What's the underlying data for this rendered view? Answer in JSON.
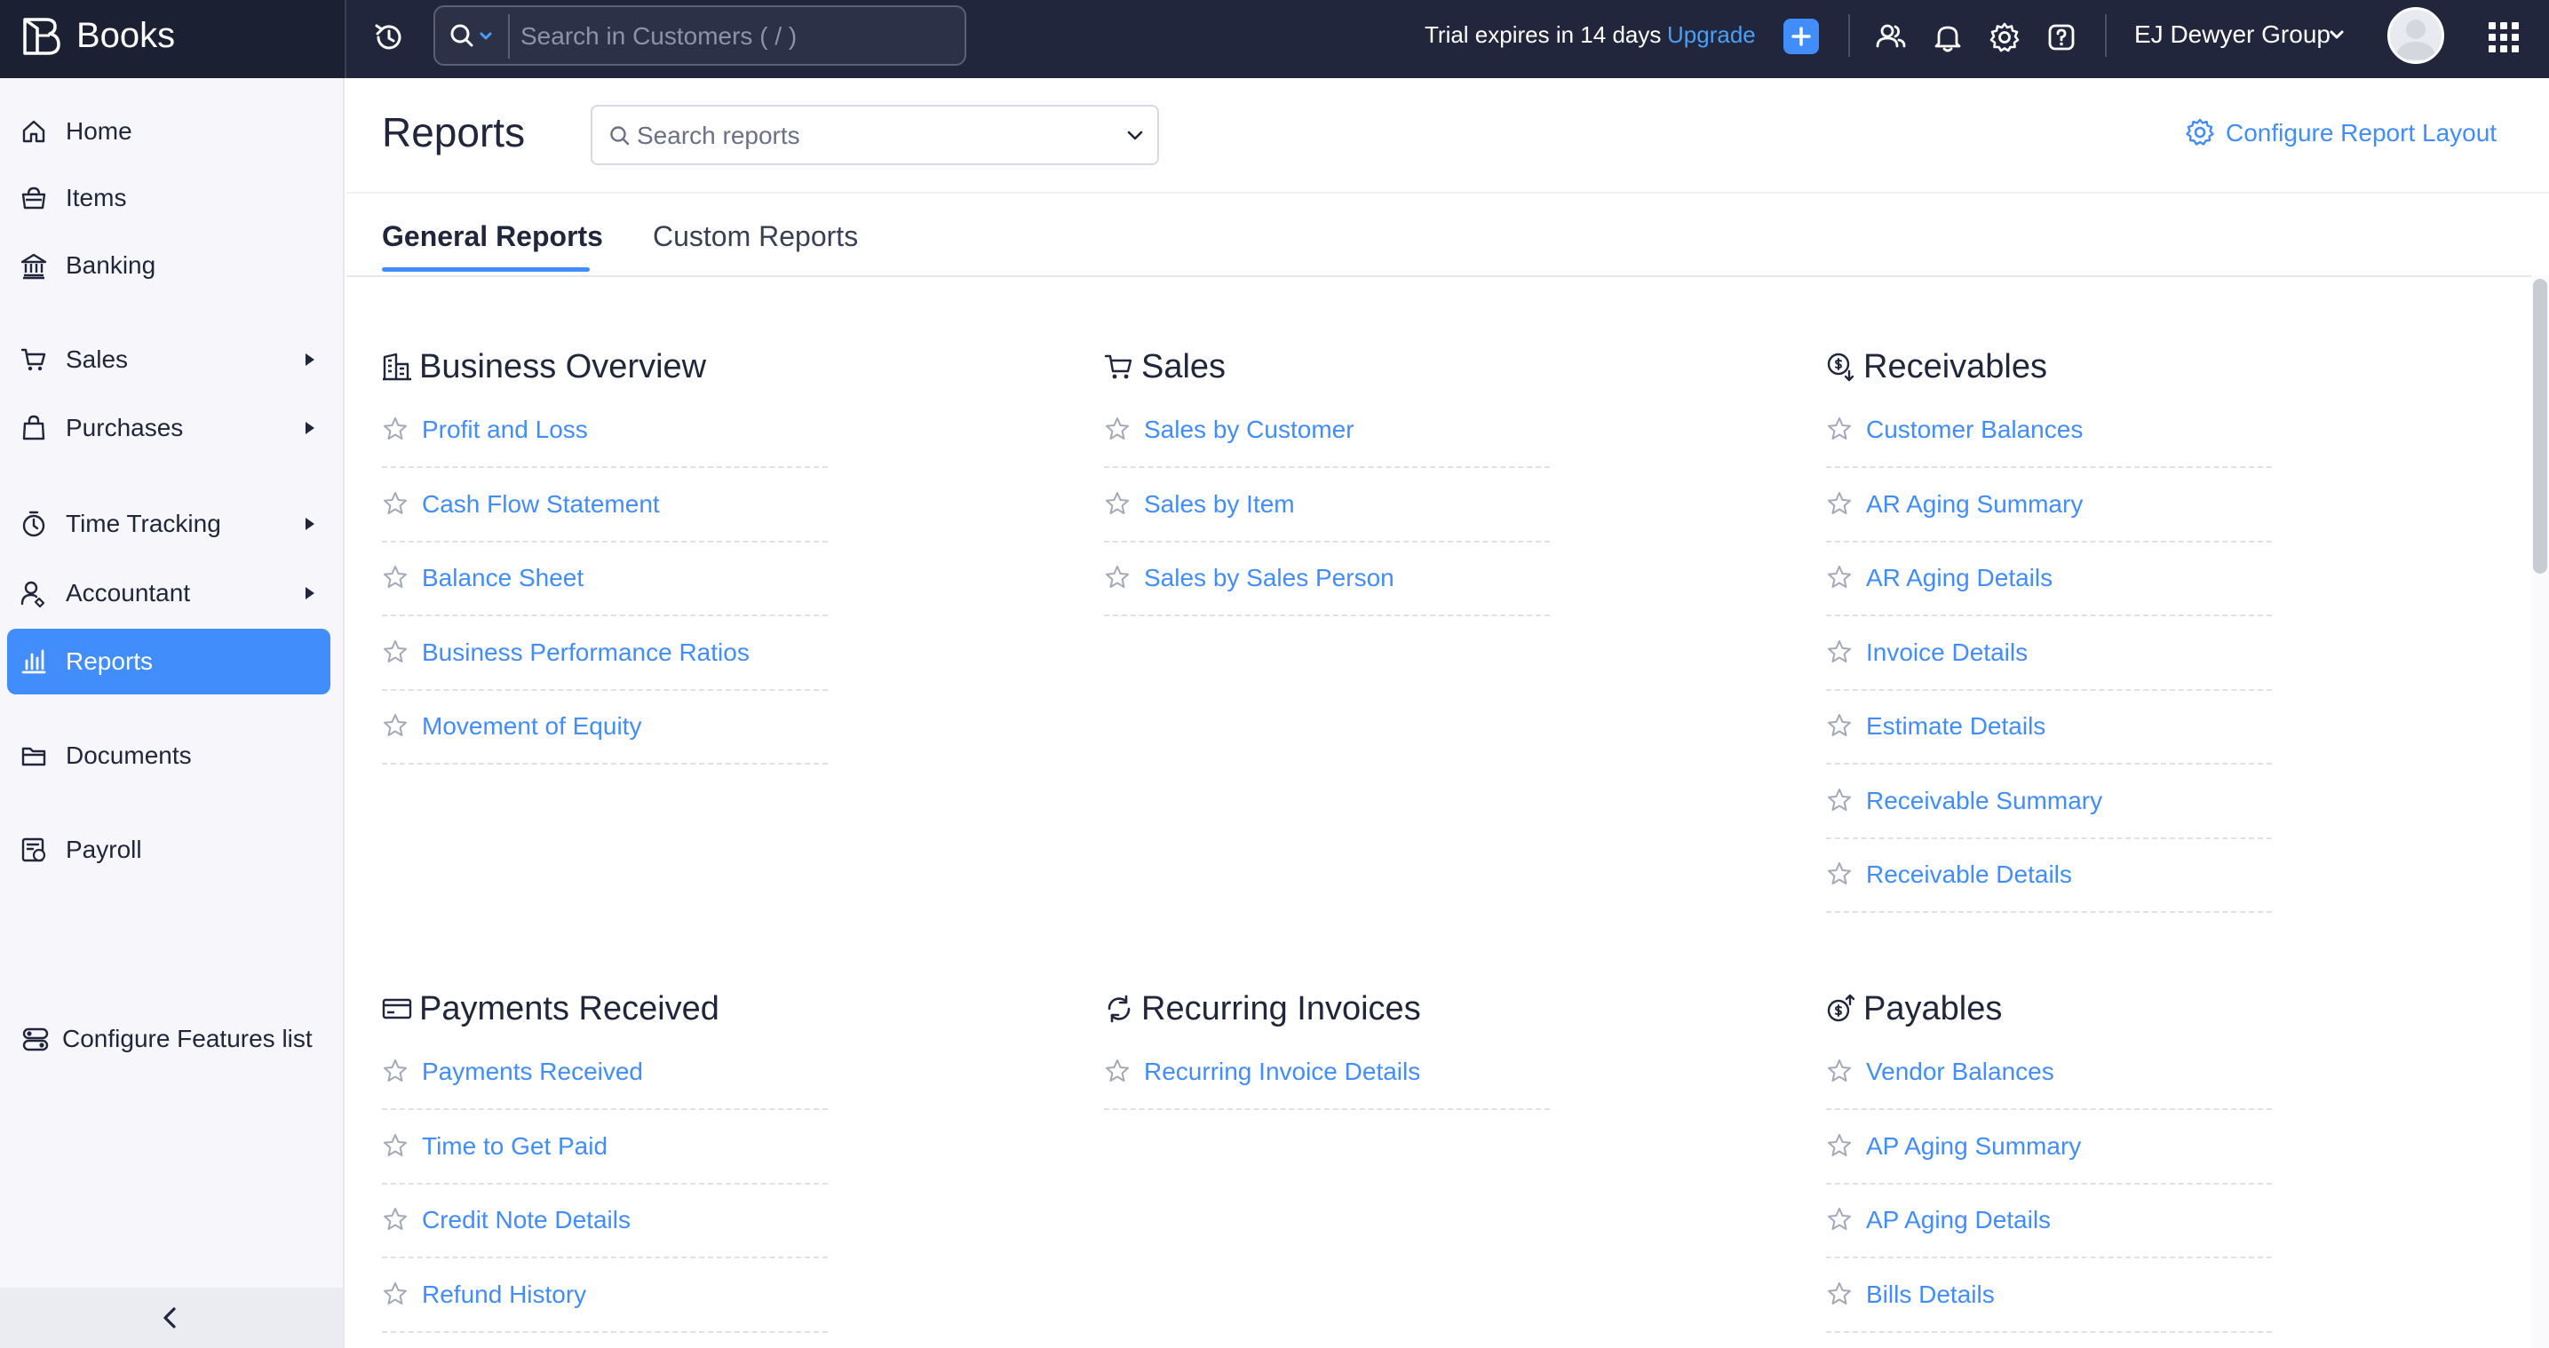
{
  "app": {
    "brand_name": "Books",
    "search_placeholder": "Search in Customers ( / )",
    "trial_text": "Trial expires in 14 days",
    "upgrade_label": "Upgrade",
    "org_name": "EJ Dewyer Group",
    "colors": {
      "topbar": "#21263c",
      "accent": "#408dfb",
      "link": "#408dfb",
      "sidebar": "#f7f7fb"
    },
    "top_icons": [
      "recent-activity-icon",
      "search-icon",
      "plus-icon",
      "users-icon",
      "bell-icon",
      "gear-icon",
      "help-icon",
      "apps-grid-icon"
    ]
  },
  "sidebar": {
    "items": [
      {
        "label": "Home",
        "icon": "home-icon",
        "has_submenu": false,
        "active": false
      },
      {
        "label": "Items",
        "icon": "basket-icon",
        "has_submenu": false,
        "active": false
      },
      {
        "label": "Banking",
        "icon": "bank-icon",
        "has_submenu": false,
        "active": false
      },
      {
        "label": "Sales",
        "icon": "cart-icon",
        "has_submenu": true,
        "active": false
      },
      {
        "label": "Purchases",
        "icon": "bag-icon",
        "has_submenu": true,
        "active": false
      },
      {
        "label": "Time Tracking",
        "icon": "stopwatch-icon",
        "has_submenu": true,
        "active": false
      },
      {
        "label": "Accountant",
        "icon": "accountant-icon",
        "has_submenu": true,
        "active": false
      },
      {
        "label": "Reports",
        "icon": "chart-icon",
        "has_submenu": false,
        "active": true
      },
      {
        "label": "Documents",
        "icon": "folder-icon",
        "has_submenu": false,
        "active": false
      },
      {
        "label": "Payroll",
        "icon": "payroll-icon",
        "has_submenu": false,
        "active": false
      }
    ],
    "configure_features_label": "Configure Features list"
  },
  "main": {
    "title": "Reports",
    "search_placeholder": "Search reports",
    "configure_layout_label": "Configure Report Layout",
    "tabs": [
      {
        "label": "General Reports",
        "active": true
      },
      {
        "label": "Custom Reports",
        "active": false
      }
    ],
    "sections": [
      {
        "title": "Business Overview",
        "icon": "buildings-icon",
        "reports": [
          "Profit and Loss",
          "Cash Flow Statement",
          "Balance Sheet",
          "Business Performance Ratios",
          "Movement of Equity"
        ]
      },
      {
        "title": "Sales",
        "icon": "cart-icon",
        "reports": [
          "Sales by Customer",
          "Sales by Item",
          "Sales by Sales Person"
        ]
      },
      {
        "title": "Receivables",
        "icon": "receivables-icon",
        "reports": [
          "Customer Balances",
          "AR Aging Summary",
          "AR Aging Details",
          "Invoice Details",
          "Estimate Details",
          "Receivable Summary",
          "Receivable Details"
        ]
      },
      {
        "title": "Payments Received",
        "icon": "card-icon",
        "reports": [
          "Payments Received",
          "Time to Get Paid",
          "Credit Note Details",
          "Refund History"
        ]
      },
      {
        "title": "Recurring Invoices",
        "icon": "recurring-icon",
        "reports": [
          "Recurring Invoice Details"
        ]
      },
      {
        "title": "Payables",
        "icon": "payables-icon",
        "reports": [
          "Vendor Balances",
          "AP Aging Summary",
          "AP Aging Details",
          "Bills Details"
        ]
      }
    ]
  }
}
